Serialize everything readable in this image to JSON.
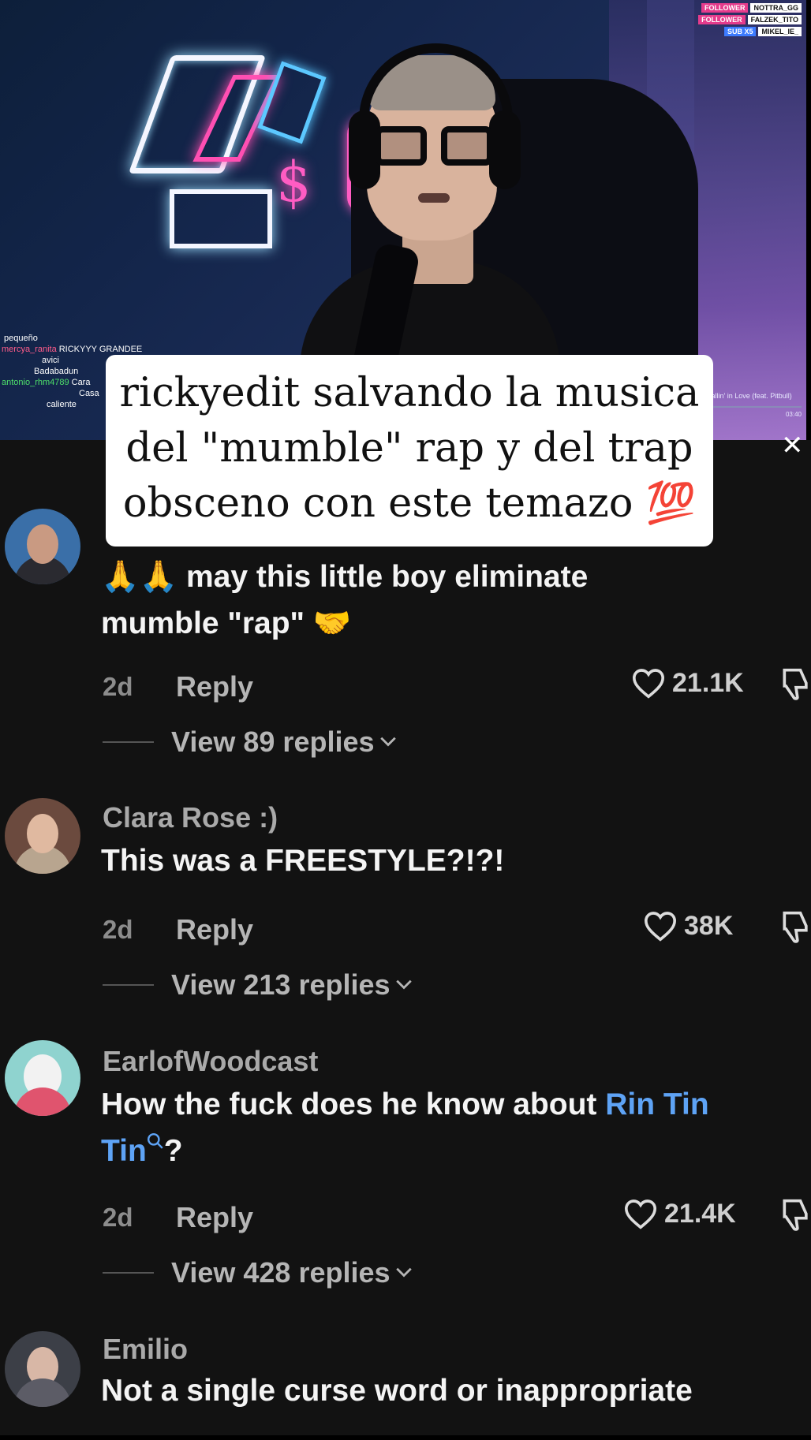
{
  "stream": {
    "alerts": [
      {
        "tag": "FOLLOWER",
        "name": "NOTTRA_GG",
        "type": "follower"
      },
      {
        "tag": "FOLLOWER",
        "name": "FALZEK_TITO",
        "type": "follower"
      },
      {
        "tag": "SUB X5",
        "name": "MIKEL_IE_",
        "type": "sub"
      }
    ],
    "chat": [
      {
        "user": "",
        "msg": "pequeño",
        "color": "#ffffff"
      },
      {
        "user": "mercya_ranita",
        "msg": "RICKYYY GRANDEE",
        "color": "#ff5c8a"
      },
      {
        "user": "",
        "msg": "avici",
        "color": "#ffffff"
      },
      {
        "user": "",
        "msg": "Badabadun",
        "color": "#ffffff"
      },
      {
        "user": "antonio_rhm4789",
        "msg": "Cara",
        "color": "#4ee06a"
      },
      {
        "user": "",
        "msg": "Casa",
        "color": "#ffffff"
      },
      {
        "user": "",
        "msg": "caliente",
        "color": "#ffffff"
      }
    ],
    "music": {
      "title": "Fallin' in Love (feat. Pitbull)",
      "time": "03:40"
    }
  },
  "caption": {
    "lines": [
      "rickyedit salvando la musica",
      "del \"mumble\" rap y del trap",
      "obsceno con este temazo 💯"
    ]
  },
  "colors": {
    "panel_bg": "#121212",
    "link": "#5ea3f5",
    "username": "#a9a9a9"
  },
  "comments": [
    {
      "username": "",
      "text_line1": "🙏🙏 may this little boy eliminate",
      "text_line2": "mumble \"rap\" 🤝",
      "date": "2d",
      "reply_label": "Reply",
      "likes": "21.1K",
      "view_replies": "View 89 replies"
    },
    {
      "username": "Clara Rose :)",
      "text_line1": "This was a FREESTYLE?!?!",
      "date": "2d",
      "reply_label": "Reply",
      "likes": "38K",
      "view_replies": "View 213 replies"
    },
    {
      "username": "EarlofWoodcast",
      "text_prefix": "How the fuck does he know about ",
      "link_text_a": "Rin Tin",
      "link_text_b": "Tin",
      "text_suffix": "?",
      "date": "2d",
      "reply_label": "Reply",
      "likes": "21.4K",
      "view_replies": "View 428 replies"
    },
    {
      "username": "Emilio",
      "text_line1": "Not a single curse word or inappropriate"
    }
  ]
}
